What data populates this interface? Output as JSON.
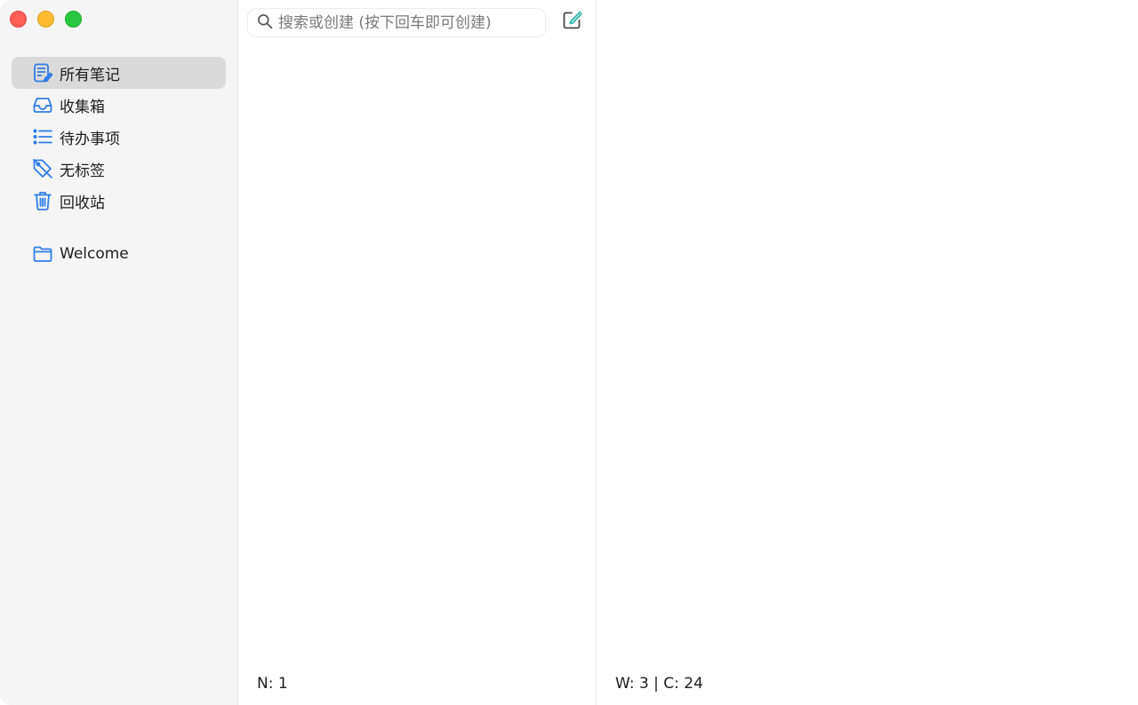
{
  "window": {
    "controls": [
      "close",
      "minimize",
      "maximize"
    ]
  },
  "sidebar": {
    "items": [
      {
        "label": "所有笔记",
        "icon": "notes-icon",
        "active": true
      },
      {
        "label": "收集箱",
        "icon": "inbox-icon",
        "active": false
      },
      {
        "label": "待办事项",
        "icon": "list-icon",
        "active": false
      },
      {
        "label": "无标签",
        "icon": "tag-off-icon",
        "active": false
      },
      {
        "label": "回收站",
        "icon": "trash-icon",
        "active": false
      }
    ],
    "folders": [
      {
        "label": "Welcome",
        "icon": "folder-icon"
      }
    ]
  },
  "notes_list": {
    "search_placeholder": "搜索或创建 (按下回车即可创建)",
    "search_value": "",
    "status": "N: 1"
  },
  "editor": {
    "status": "W: 3 | C: 24"
  },
  "colors": {
    "accent": "#2f7ee6",
    "compose_accent": "#2bb5a8",
    "sidebar_bg": "#f5f5f5",
    "active_item_bg": "#dadada"
  }
}
